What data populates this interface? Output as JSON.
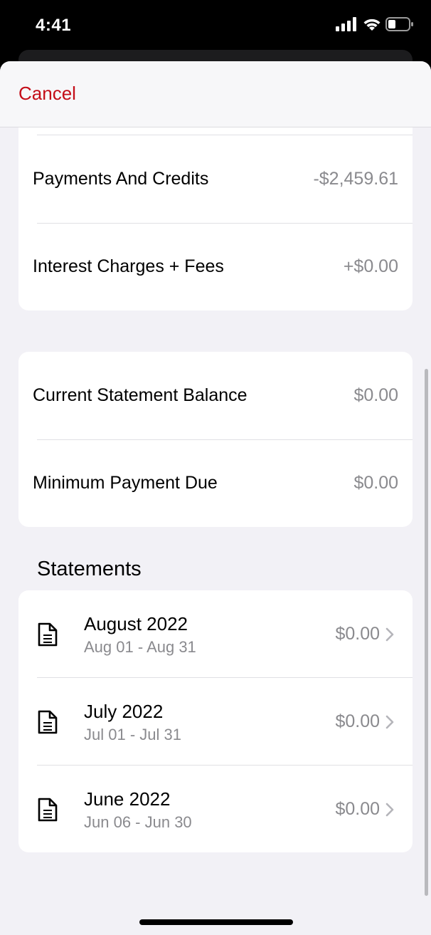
{
  "status_bar": {
    "time": "4:41",
    "icons": [
      "cellular-signal-icon",
      "wifi-icon",
      "battery-icon"
    ]
  },
  "nav": {
    "cancel_label": "Cancel"
  },
  "summary_card": {
    "rows": [
      {
        "label": "Payments And Credits",
        "value": "-$2,459.61"
      },
      {
        "label": "Interest Charges + Fees",
        "value": "+$0.00"
      }
    ]
  },
  "balance_card": {
    "rows": [
      {
        "label": "Current Statement Balance",
        "value": "$0.00"
      },
      {
        "label": "Minimum Payment Due",
        "value": "$0.00"
      }
    ]
  },
  "statements": {
    "title": "Statements",
    "items": [
      {
        "title": "August 2022",
        "range": "Aug 01 - Aug 31",
        "amount": "$0.00"
      },
      {
        "title": "July 2022",
        "range": "Jul 01 - Jul 31",
        "amount": "$0.00"
      },
      {
        "title": "June 2022",
        "range": "Jun 06 - Jun 30",
        "amount": "$0.00"
      }
    ]
  },
  "colors": {
    "accent": "#c40d18",
    "secondary_text": "#8a8a8e",
    "sheet_background": "#f2f1f6"
  }
}
